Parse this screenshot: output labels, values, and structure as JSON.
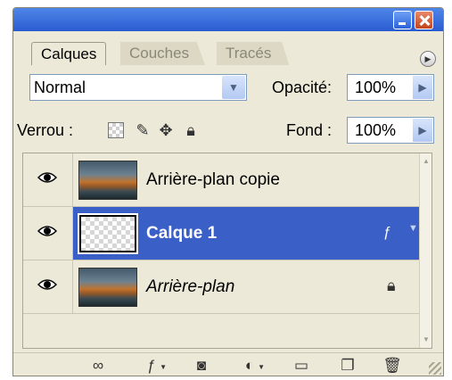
{
  "tabs": [
    "Calques",
    "Couches",
    "Tracés"
  ],
  "blend_mode": "Normal",
  "opacity": {
    "label": "Opacité:",
    "value": "100%"
  },
  "lock": {
    "label": "Verrou :"
  },
  "fill": {
    "label": "Fond :",
    "value": "100%"
  },
  "layers": [
    {
      "name": "Arrière-plan copie",
      "visible": true,
      "selected": false
    },
    {
      "name": "Calque 1",
      "visible": true,
      "selected": true,
      "has_effects": true
    },
    {
      "name": "Arrière-plan",
      "visible": true,
      "selected": false,
      "locked": true
    }
  ],
  "icons": {
    "title_bar": [
      "minimize-icon",
      "close-icon"
    ],
    "panel_menu": "panel-menu-icon",
    "lock": [
      "lock-transparency-icon",
      "lock-pixels-icon",
      "lock-position-icon",
      "lock-all-icon"
    ],
    "toolbar": [
      "link-icon",
      "layer-style-icon",
      "layer-mask-icon",
      "adjustment-layer-icon",
      "new-group-icon",
      "new-layer-icon",
      "trash-icon"
    ]
  },
  "colors": {
    "selection": "#3a5fc6",
    "panel": "#ece9d8",
    "title_bar": "#2a5bd0"
  }
}
